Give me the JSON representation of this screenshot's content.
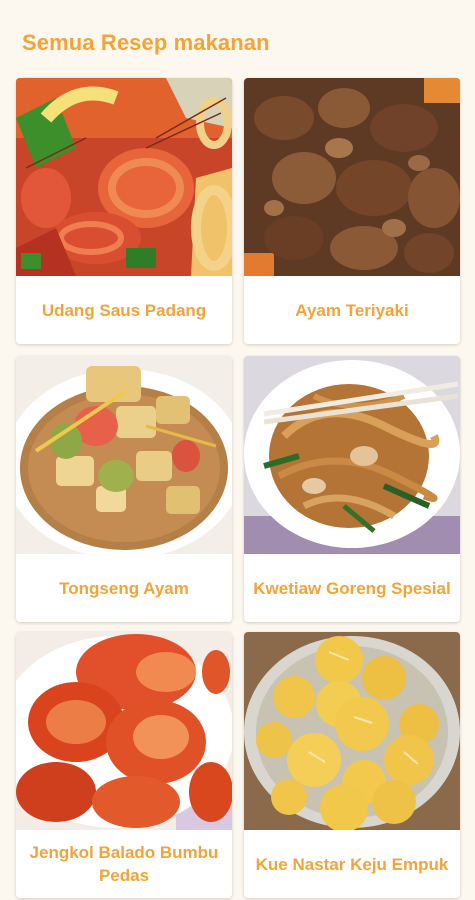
{
  "header": {
    "title": "Semua Resep makanan"
  },
  "theme": {
    "accent": "#f2a33a",
    "background": "#fdf8ef",
    "card": "#ffffff"
  },
  "recipes": [
    {
      "title": "Udang Saus Padang",
      "image": "shrimp-padang-sauce-photo"
    },
    {
      "title": "Ayam Teriyaki",
      "image": "chicken-teriyaki-photo"
    },
    {
      "title": "Tongseng Ayam",
      "image": "chicken-tongseng-curry-photo"
    },
    {
      "title": "Kwetiaw Goreng Spesial",
      "image": "fried-flat-noodles-photo"
    },
    {
      "title": "Jengkol Balado Bumbu Pedas",
      "image": "spicy-balado-photo"
    },
    {
      "title": "Kue Nastar Keju Empuk",
      "image": "cheese-pastry-balls-photo"
    }
  ]
}
